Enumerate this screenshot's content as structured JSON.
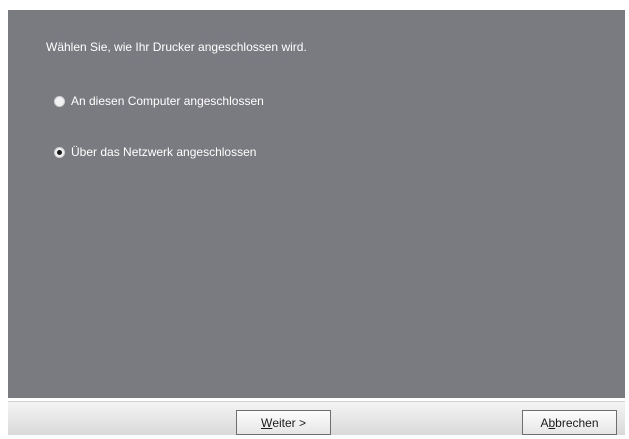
{
  "dialog": {
    "prompt": "Wählen Sie, wie Ihr Drucker angeschlossen wird.",
    "options": [
      {
        "label": "An diesen Computer angeschlossen",
        "selected": false
      },
      {
        "label": "Über das Netzwerk angeschlossen",
        "selected": true
      }
    ]
  },
  "buttons": {
    "next": {
      "mnemonic": "W",
      "rest": "eiter >"
    },
    "cancel": {
      "prefix": "A",
      "mnemonic": "b",
      "rest": "brechen"
    }
  },
  "colors": {
    "panel_background": "#7a7b80",
    "text": "#ffffff"
  }
}
